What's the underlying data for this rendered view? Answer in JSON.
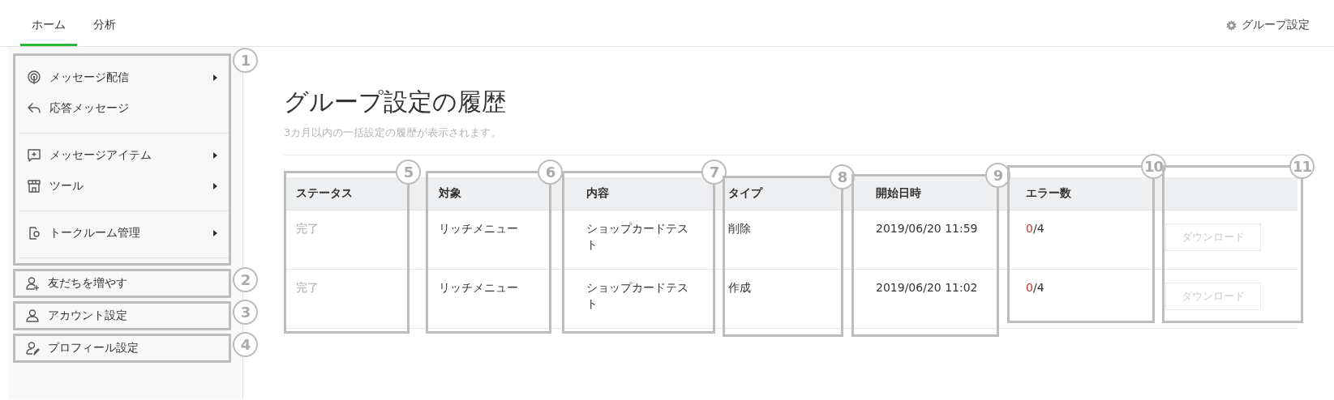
{
  "tabs": [
    {
      "label": "ホーム",
      "selected": true
    },
    {
      "label": "分析",
      "selected": false
    }
  ],
  "group_settings_link": "グループ設定",
  "sidebar": {
    "menu": {
      "callout": "1",
      "sections": [
        {
          "items": [
            {
              "label": "メッセージ配信",
              "submenu": true
            },
            {
              "label": "応答メッセージ",
              "submenu": false
            }
          ]
        },
        {
          "items": [
            {
              "label": "メッセージアイテム",
              "submenu": true
            },
            {
              "label": "ツール",
              "submenu": true
            }
          ]
        },
        {
          "items": [
            {
              "label": "トークルーム管理",
              "submenu": true
            }
          ]
        }
      ]
    },
    "links": [
      {
        "label": "友だちを増やす",
        "callout": "2"
      },
      {
        "label": "アカウント設定",
        "callout": "3"
      },
      {
        "label": "プロフィール設定",
        "callout": "4"
      }
    ]
  },
  "page": {
    "title": "グループ設定の履歴",
    "subtitle": "3カ月以内の一括設定の履歴が表示されます。"
  },
  "table": {
    "columns": [
      {
        "label": "ステータス",
        "callout": "5"
      },
      {
        "label": "対象",
        "callout": "6"
      },
      {
        "label": "内容",
        "callout": "7"
      },
      {
        "label": "タイプ",
        "callout": "8"
      },
      {
        "label": "開始日時",
        "callout": "9"
      },
      {
        "label": "エラー数",
        "callout": "10"
      },
      {
        "callout": "11"
      }
    ],
    "rows": [
      {
        "status": "完了",
        "target": "リッチメニュー",
        "content": "ショップカードテスト",
        "type": "削除",
        "started": "2019/06/20 11:59",
        "errors": {
          "count": "0",
          "total": "/4"
        },
        "download": {
          "label": "ダウンロード",
          "disabled": true
        }
      },
      {
        "status": "完了",
        "target": "リッチメニュー",
        "content": "ショップカードテスト",
        "type": "作成",
        "started": "2019/06/20 11:02",
        "errors": {
          "count": "0",
          "total": "/4"
        },
        "download": {
          "label": "ダウンロード",
          "disabled": true
        }
      }
    ]
  }
}
